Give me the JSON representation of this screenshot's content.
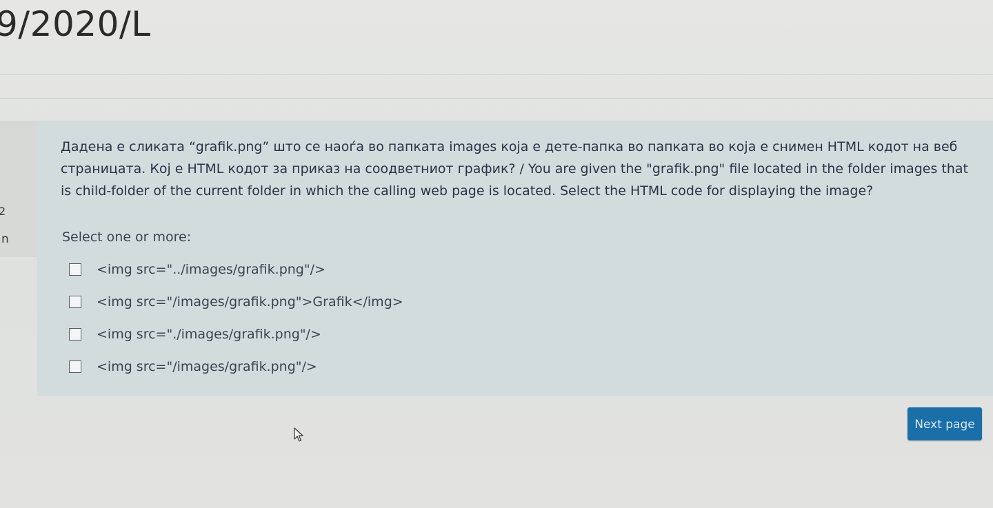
{
  "header": {
    "course_title": "9/2020/L"
  },
  "sidebar_info": {
    "question_number": "2",
    "status_fragment": "n"
  },
  "question": {
    "text": "Дадена е сликата “grafik.png” што се наоѓа во папката images која е дете-папка во папката во која е снимен HTML кодот на веб страницата. Кој е HTML кодот за приказ на соодветниот график? / You are given the \"grafik.png\" file located in the folder images that is child-folder of the current folder in which the calling web page is located. Select the HTML code for displaying the image?",
    "prompt": "Select one or more:",
    "options": [
      {
        "label": "<img src=\"../images/grafik.png\"/>",
        "checked": false
      },
      {
        "label": "<img src=\"/images/grafik.png\">Grafik</img>",
        "checked": false
      },
      {
        "label": "<img src=\"./images/grafik.png\"/>",
        "checked": false
      },
      {
        "label": "<img src=\"/images/grafik.png\"/>",
        "checked": false
      }
    ]
  },
  "navigation": {
    "next_label": "Next page"
  },
  "colors": {
    "question_background": "#d3dcdd",
    "button_background": "#1a6fa8"
  },
  "icons": {
    "cursor": "mouse-pointer-icon",
    "checkbox": "checkbox-icon"
  }
}
